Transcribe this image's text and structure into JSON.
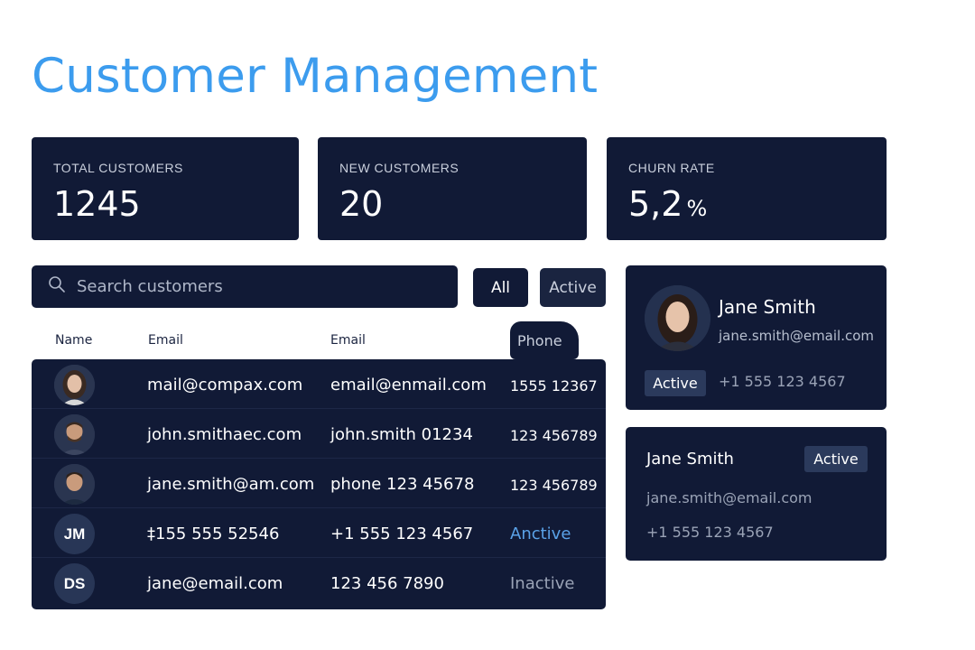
{
  "page": {
    "title": "Customer Management"
  },
  "stats": [
    {
      "label": "TOTAL CUSTOMERS",
      "value": "1245",
      "unit": ""
    },
    {
      "label": "NEW CUSTOMERS",
      "value": "20",
      "unit": ""
    },
    {
      "label": "CHURN RATE",
      "value": "5,2",
      "unit": "%"
    }
  ],
  "search": {
    "placeholder": "Search customers",
    "icon": "search-icon"
  },
  "filters": {
    "all_label": "All",
    "active_label": "Active"
  },
  "table": {
    "headers": [
      "Name",
      "Email",
      "Email",
      "Phone"
    ],
    "rows": [
      {
        "avatar": "photo",
        "initials": "",
        "col1": "mail@compax.com",
        "col2": "email@enmail.com",
        "col3": "1555 12367"
      },
      {
        "avatar": "photo",
        "initials": "",
        "col1": "john.smithaec.com",
        "col2": "john.smith 01234",
        "col3": "123 456789"
      },
      {
        "avatar": "photo",
        "initials": "",
        "col1": "jane.smith@am.com",
        "col2": "phone 123 45678",
        "col3": "123 456789"
      },
      {
        "avatar": "initials",
        "initials": "JM",
        "col1": "‡155 555 52546",
        "col2": "+1 555 123 4567",
        "col3": "Anctive"
      },
      {
        "avatar": "initials",
        "initials": "DS",
        "col1": "jane@email.com",
        "col2": "123 456 7890",
        "col3": "Inactive"
      }
    ]
  },
  "profile_card": {
    "name": "Jane Smith",
    "email": "jane.smith@email.com",
    "status": "Active",
    "phone": "+1 555 123 4567"
  },
  "contact_card": {
    "name": "Jane Smith",
    "status": "Active",
    "email": "jane.smith@email.com",
    "phone": "+1 555 123 4567"
  },
  "colors": {
    "accent": "#3c9cee",
    "panel": "#111a36",
    "badge": "#2b3a5c",
    "status_active_link": "#5aa2e8",
    "status_inactive": "#9aa3b6"
  }
}
